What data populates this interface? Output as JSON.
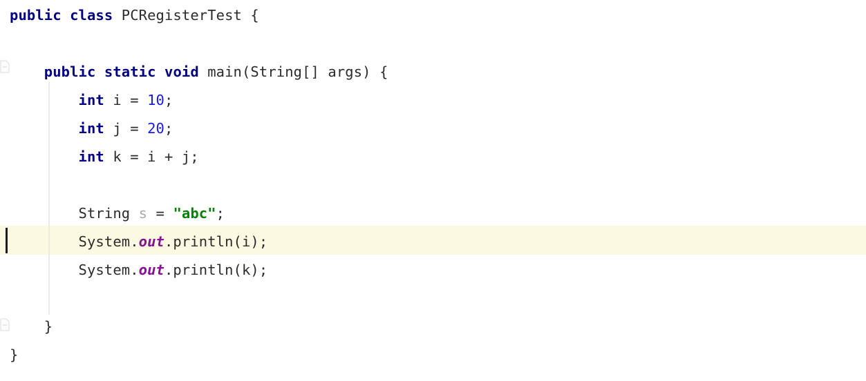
{
  "editor": {
    "language": "java",
    "theme": "light",
    "background_color": "#ffffff",
    "current_line_highlight_color": "#fcf9e3",
    "indent_guide_color": "#e9e9ee",
    "caret_color": "#1b1b1b",
    "syntax_colors": {
      "keyword": "#000080",
      "number": "#1a1ae0",
      "string": "#048004",
      "static_field": "#871094",
      "identifier": "#2b2b2b",
      "unused_identifier": "#a8a8a8"
    },
    "class_name": "PCRegisterTest",
    "current_line_number": 9
  },
  "gutter": {
    "fold_markers": [
      {
        "name": "fold-marker-method",
        "state": "expanded"
      },
      {
        "name": "fold-marker-class-end",
        "state": "expanded"
      }
    ]
  },
  "lines": [
    {
      "id": "line-1",
      "name": "code-line-class-declaration",
      "text": "public class PCRegisterTest {",
      "tokens": [
        {
          "t": "public",
          "c": "tok-kw"
        },
        {
          "t": " ",
          "c": "tok-plain"
        },
        {
          "t": "class",
          "c": "tok-kw"
        },
        {
          "t": " ",
          "c": "tok-plain"
        },
        {
          "t": "PCRegisterTest",
          "c": "tok-class"
        },
        {
          "t": " {",
          "c": "tok-plain"
        }
      ]
    },
    {
      "id": "line-2",
      "name": "code-line-blank-1",
      "text": "",
      "tokens": []
    },
    {
      "id": "line-3",
      "name": "code-line-main-signature",
      "text": "    public static void main(String[] args) {",
      "tokens": [
        {
          "t": "    ",
          "c": "tok-plain"
        },
        {
          "t": "public",
          "c": "tok-kw"
        },
        {
          "t": " ",
          "c": "tok-plain"
        },
        {
          "t": "static",
          "c": "tok-kw"
        },
        {
          "t": " ",
          "c": "tok-plain"
        },
        {
          "t": "void",
          "c": "tok-kw"
        },
        {
          "t": " main(String[] args) {",
          "c": "tok-plain"
        }
      ]
    },
    {
      "id": "line-4",
      "name": "code-line-int-i",
      "text": "        int i = 10;",
      "tokens": [
        {
          "t": "        ",
          "c": "tok-plain"
        },
        {
          "t": "int",
          "c": "tok-kw"
        },
        {
          "t": " i = ",
          "c": "tok-plain"
        },
        {
          "t": "10",
          "c": "tok-num"
        },
        {
          "t": ";",
          "c": "tok-plain"
        }
      ]
    },
    {
      "id": "line-5",
      "name": "code-line-int-j",
      "text": "        int j = 20;",
      "tokens": [
        {
          "t": "        ",
          "c": "tok-plain"
        },
        {
          "t": "int",
          "c": "tok-kw"
        },
        {
          "t": " j = ",
          "c": "tok-plain"
        },
        {
          "t": "20",
          "c": "tok-num"
        },
        {
          "t": ";",
          "c": "tok-plain"
        }
      ]
    },
    {
      "id": "line-6",
      "name": "code-line-int-k",
      "text": "        int k = i + j;",
      "tokens": [
        {
          "t": "        ",
          "c": "tok-plain"
        },
        {
          "t": "int",
          "c": "tok-kw"
        },
        {
          "t": " k = i + j;",
          "c": "tok-plain"
        }
      ]
    },
    {
      "id": "line-7",
      "name": "code-line-blank-2",
      "text": "",
      "tokens": []
    },
    {
      "id": "line-8",
      "name": "code-line-string-s",
      "text": "        String s = \"abc\";",
      "tokens": [
        {
          "t": "        ",
          "c": "tok-plain"
        },
        {
          "t": "String",
          "c": "tok-plain"
        },
        {
          "t": " ",
          "c": "tok-plain"
        },
        {
          "t": "s",
          "c": "tok-dim"
        },
        {
          "t": " = ",
          "c": "tok-plain"
        },
        {
          "t": "\"abc\"",
          "c": "tok-str"
        },
        {
          "t": ";",
          "c": "tok-plain"
        }
      ]
    },
    {
      "id": "line-9",
      "name": "code-line-println-i",
      "text": "        System.out.println(i);",
      "tokens": [
        {
          "t": "        ",
          "c": "tok-plain"
        },
        {
          "t": "System.",
          "c": "tok-plain"
        },
        {
          "t": "out",
          "c": "tok-field"
        },
        {
          "t": ".println(i);",
          "c": "tok-plain"
        }
      ]
    },
    {
      "id": "line-10",
      "name": "code-line-println-k",
      "text": "        System.out.println(k);",
      "tokens": [
        {
          "t": "        ",
          "c": "tok-plain"
        },
        {
          "t": "System.",
          "c": "tok-plain"
        },
        {
          "t": "out",
          "c": "tok-field"
        },
        {
          "t": ".println(k);",
          "c": "tok-plain"
        }
      ]
    },
    {
      "id": "line-11",
      "name": "code-line-blank-3",
      "text": "",
      "tokens": []
    },
    {
      "id": "line-12",
      "name": "code-line-method-close-brace",
      "text": "    }",
      "tokens": [
        {
          "t": "    }",
          "c": "tok-plain"
        }
      ]
    },
    {
      "id": "line-13",
      "name": "code-line-class-close-brace",
      "text": "}",
      "tokens": [
        {
          "t": "}",
          "c": "tok-plain"
        }
      ]
    }
  ]
}
